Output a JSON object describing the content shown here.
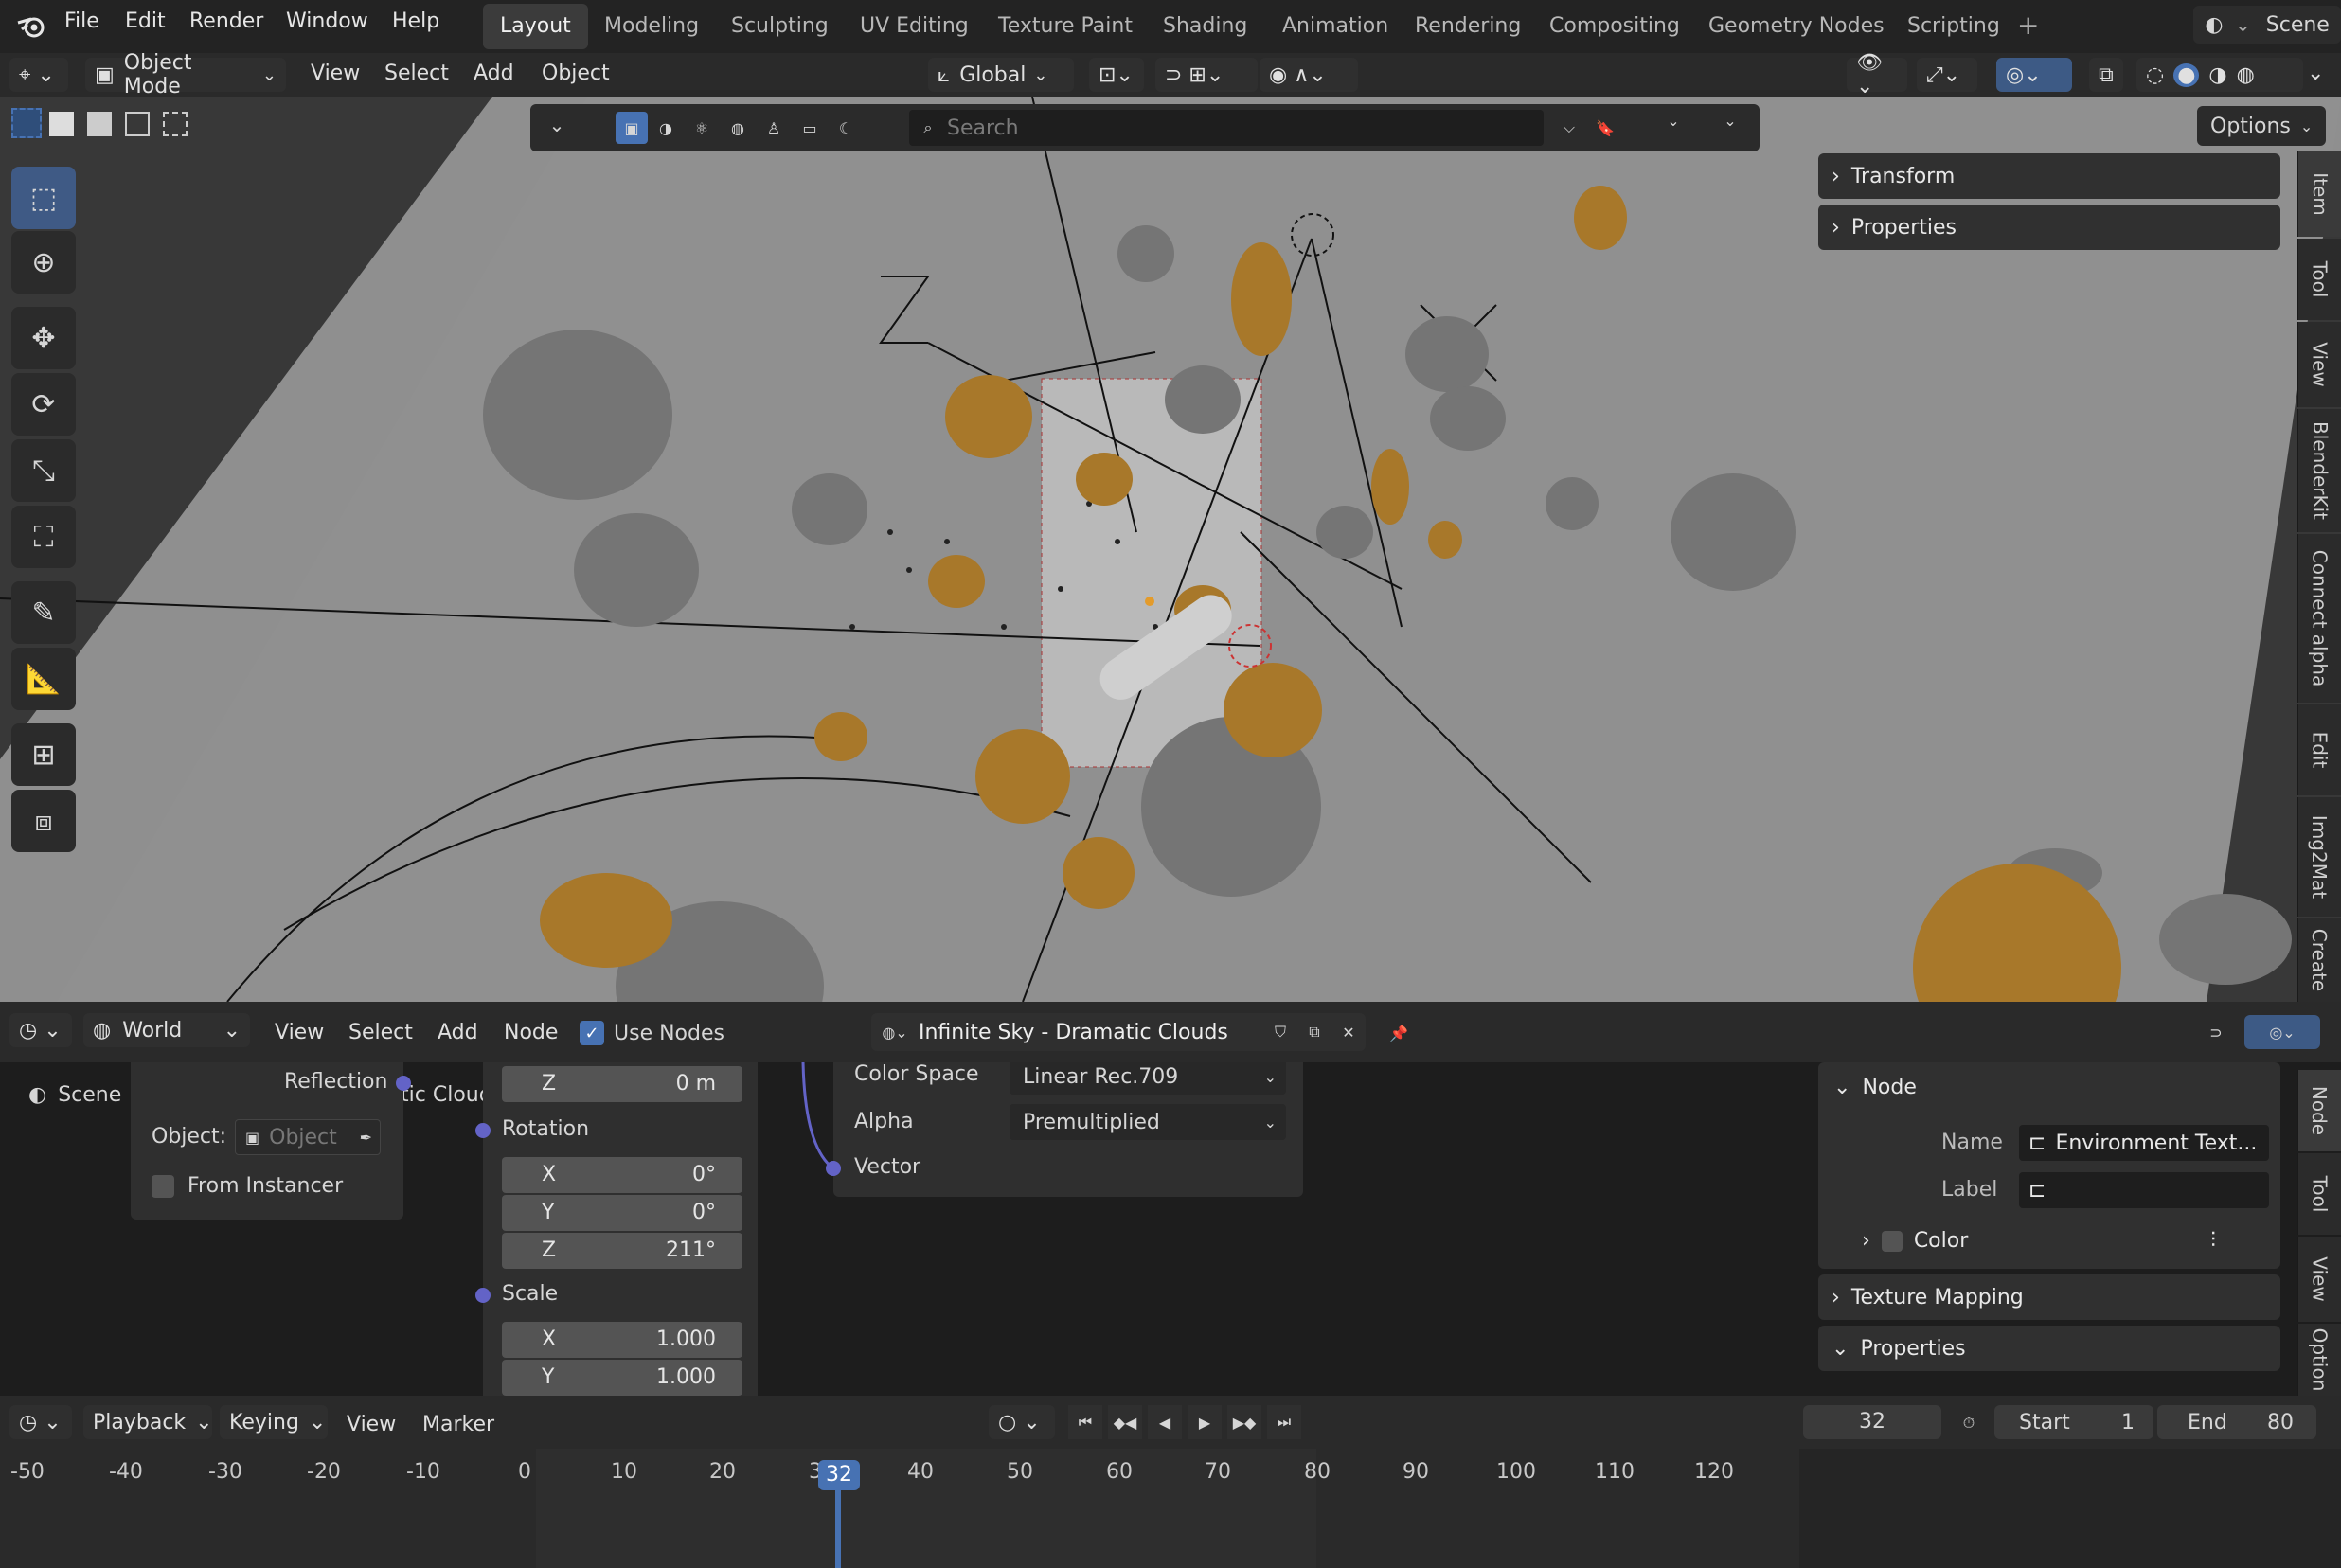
{
  "menu": {
    "file": "File",
    "edit": "Edit",
    "render": "Render",
    "window": "Window",
    "help": "Help"
  },
  "workspaces": [
    "Layout",
    "Modeling",
    "Sculpting",
    "UV Editing",
    "Texture Paint",
    "Shading",
    "Animation",
    "Rendering",
    "Compositing",
    "Geometry Nodes",
    "Scripting"
  ],
  "active_workspace": "Layout",
  "scene_label": "Scene",
  "viewport_header": {
    "mode": "Object Mode",
    "view": "View",
    "select": "Select",
    "add": "Add",
    "object": "Object",
    "orientation": "Global"
  },
  "viewport_toolbar": {
    "search_placeholder": "Search",
    "options": "Options"
  },
  "n_panel": {
    "transform": "Transform",
    "properties": "Properties"
  },
  "viewport_tabs": [
    "Item",
    "Tool",
    "View",
    "BlenderKit",
    "Connect alpha",
    "Edit",
    "Img2Mat",
    "Create"
  ],
  "node_header": {
    "type": "World",
    "view": "View",
    "select": "Select",
    "add": "Add",
    "node": "Node",
    "use_nodes": "Use Nodes",
    "world_name": "Infinite Sky - Dramatic Clouds"
  },
  "node_editor": {
    "breadcrumb_scene": "Scene",
    "breadcrumb_world": "Infinite Sky - Dramatic Clouds",
    "reflection": "Reflection",
    "object_label": "Object:",
    "object_placeholder": "Object",
    "from_instancer": "From Instancer",
    "z_label": "Z",
    "z_value": "0 m",
    "rotation": "Rotation",
    "rx_label": "X",
    "rx": "0°",
    "ry_label": "Y",
    "ry": "0°",
    "rz_label": "Z",
    "rz": "211°",
    "scale": "Scale",
    "sx_label": "X",
    "sx": "1.000",
    "sy_label": "Y",
    "sy": "1.000",
    "color_space_label": "Color Space",
    "color_space": "Linear Rec.709",
    "alpha_label": "Alpha",
    "alpha": "Premultiplied",
    "vector": "Vector"
  },
  "node_panel": {
    "node": "Node",
    "name_label": "Name",
    "name_value": "Environment Text...",
    "label_label": "Label",
    "color": "Color",
    "texture_mapping": "Texture Mapping",
    "properties": "Properties"
  },
  "node_tabs": [
    "Node",
    "Tool",
    "View",
    "Option"
  ],
  "timeline": {
    "playback": "Playback",
    "keying": "Keying",
    "view": "View",
    "marker": "Marker",
    "current_frame": "32",
    "start_label": "Start",
    "start": "1",
    "end_label": "End",
    "end": "80",
    "ticks": [
      "-50",
      "-40",
      "-30",
      "-20",
      "-10",
      "0",
      "10",
      "20",
      "30",
      "40",
      "50",
      "60",
      "70",
      "80",
      "90",
      "100",
      "110",
      "120"
    ]
  },
  "colors": {
    "accent": "#4772b3",
    "orange": "#a8782a",
    "socket": "#6363c7"
  }
}
